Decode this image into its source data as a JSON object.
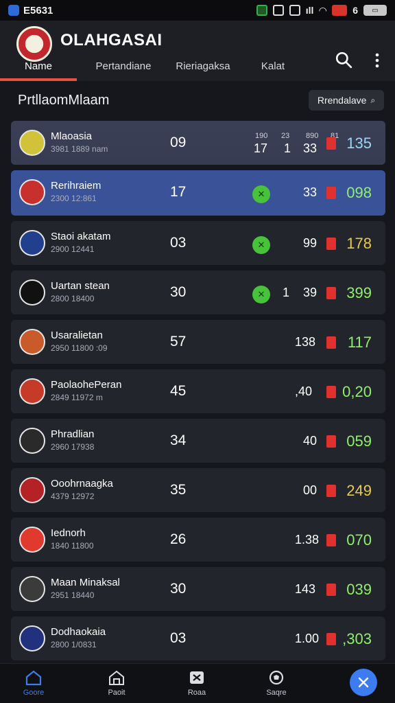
{
  "status": {
    "time": "E5631",
    "network_label": "6"
  },
  "app": {
    "title": "OLAHGASAI",
    "tabs": [
      "Name",
      "Pertandiane",
      "Rieriagaksa",
      "Kalat"
    ]
  },
  "section": {
    "title": "PrtllaomMlaam",
    "filter_label": "Rrendalave"
  },
  "rows": [
    {
      "name": "Mlaoasia",
      "sub": "3981 1889 nam",
      "rank": "09",
      "head": [
        "190",
        "23",
        "890",
        "81"
      ],
      "c1": "17",
      "c2": "1",
      "c3": "33",
      "value": "135",
      "value_color": "#9ad8f5",
      "crest_color": "#d2c23a",
      "style": "highlight"
    },
    {
      "name": "Rerihraiem",
      "sub": "2300 12:861",
      "rank": "17",
      "c3": "33",
      "value": "098",
      "value_color": "#8ff06a",
      "crest_color": "#c7302c",
      "style": "selected"
    },
    {
      "name": "Staoi akatam",
      "sub": "2900 12441",
      "rank": "03",
      "c3": "99",
      "value": "178",
      "value_color": "#e8cb48",
      "crest_color": "#213f8c"
    },
    {
      "name": "Uartan stean",
      "sub": "2800 18400",
      "rank": "30",
      "c1": "1",
      "c3": "39",
      "value": "399",
      "value_color": "#8ff06a",
      "crest_color": "#111111"
    },
    {
      "name": "Usaralietan",
      "sub": "2950 11800 :09",
      "rank": "57",
      "c3": "138",
      "value": "117",
      "value_color": "#8ff06a",
      "crest_color": "#c95a2a"
    },
    {
      "name": "PaolaohePeran",
      "sub": "2849 11972 m",
      "rank": "45",
      "c3": ",40",
      "value": "0,20",
      "value_color": "#8ff06a",
      "crest_color": "#c63a28"
    },
    {
      "name": "Phradlian",
      "sub": "2960 17938",
      "rank": "34",
      "c3": "40",
      "value": "059",
      "value_color": "#8ff06a",
      "crest_color": "#2a2a2a"
    },
    {
      "name": "Ooohrnaagka",
      "sub": "4379 12972",
      "rank": "35",
      "c3": "00",
      "value": "249",
      "value_color": "#e8cb48",
      "crest_color": "#b42226"
    },
    {
      "name": "Iednorh",
      "sub": "1840 11800",
      "rank": "26",
      "c3": "1.38",
      "value": "070",
      "value_color": "#8ff06a",
      "crest_color": "#e0392d"
    },
    {
      "name": "Maan Minaksal",
      "sub": "2951 18440",
      "rank": "30",
      "c3": "143",
      "value": "039",
      "value_color": "#8ff06a",
      "crest_color": "#3b3b3b"
    },
    {
      "name": "Dodhaokaia",
      "sub": "2800 1/0831",
      "rank": "03",
      "c3": "1.00",
      "value": ",303",
      "value_color": "#8ff06a",
      "crest_color": "#22317e"
    }
  ],
  "nav": [
    {
      "label": "Goore"
    },
    {
      "label": "Paoit"
    },
    {
      "label": "Roaa"
    },
    {
      "label": "Saqre"
    }
  ]
}
